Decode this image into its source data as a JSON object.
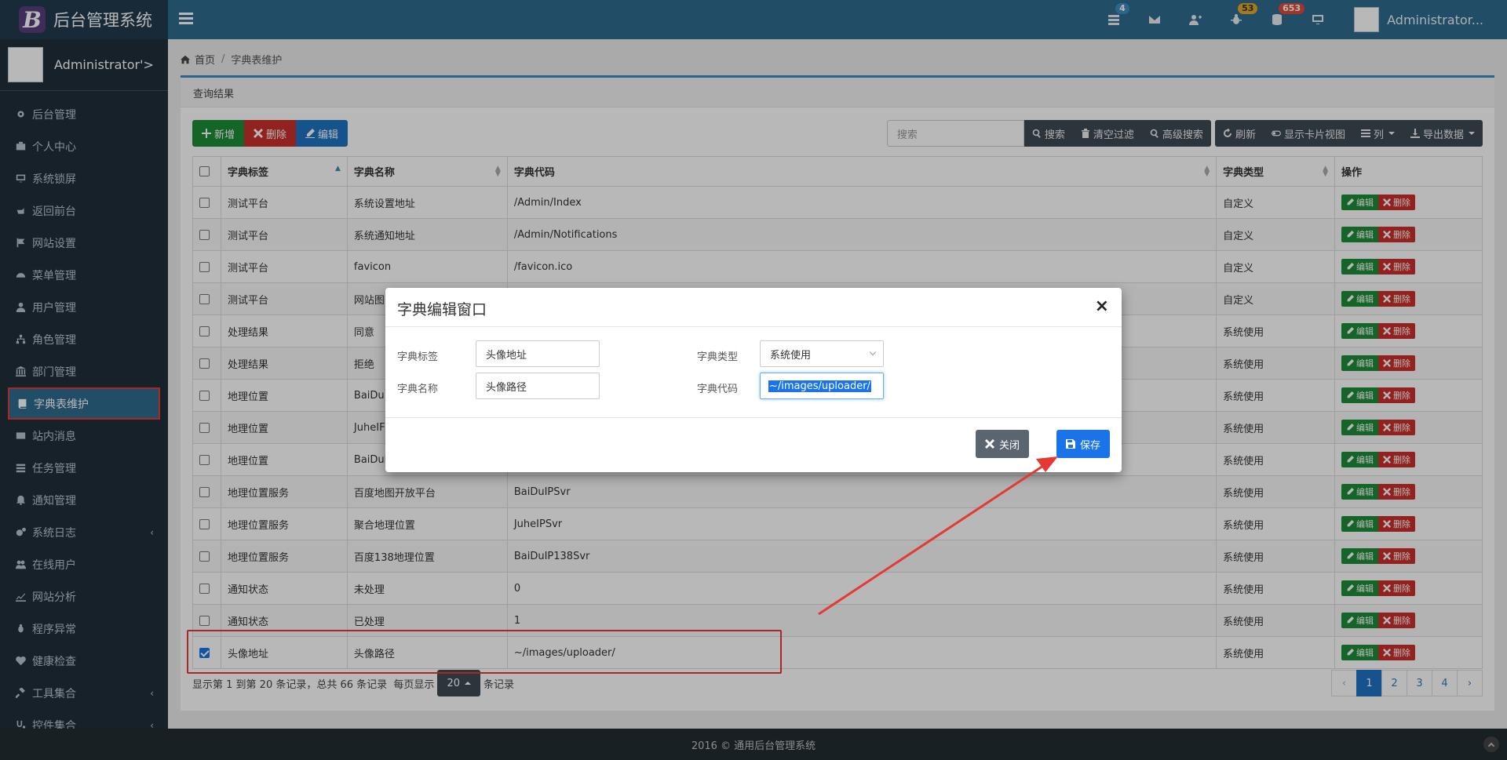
{
  "header": {
    "app_title": "后台管理系统",
    "logo_letter": "B",
    "user_name": "Administrator...",
    "badges": {
      "tasks": "4",
      "alerts": "53",
      "messages": "653"
    }
  },
  "sidebar": {
    "user_name": "Administrator'>",
    "items": [
      {
        "label": "后台管理",
        "icon": "gear-icon"
      },
      {
        "label": "个人中心",
        "icon": "briefcase-icon"
      },
      {
        "label": "系统锁屏",
        "icon": "monitor-icon"
      },
      {
        "label": "返回前台",
        "icon": "hand-pointer-icon"
      },
      {
        "label": "网站设置",
        "icon": "flag-icon"
      },
      {
        "label": "菜单管理",
        "icon": "dashboard-icon"
      },
      {
        "label": "用户管理",
        "icon": "user-icon"
      },
      {
        "label": "角色管理",
        "icon": "sitemap-icon"
      },
      {
        "label": "部门管理",
        "icon": "bank-icon"
      },
      {
        "label": "字典表维护",
        "icon": "book-icon"
      },
      {
        "label": "站内消息",
        "icon": "envelope-icon"
      },
      {
        "label": "任务管理",
        "icon": "tasks-icon"
      },
      {
        "label": "通知管理",
        "icon": "bell-icon"
      },
      {
        "label": "系统日志",
        "icon": "gears-icon"
      },
      {
        "label": "在线用户",
        "icon": "users-icon"
      },
      {
        "label": "网站分析",
        "icon": "line-chart-icon"
      },
      {
        "label": "程序异常",
        "icon": "bug-icon"
      },
      {
        "label": "健康检查",
        "icon": "heartbeat-icon"
      },
      {
        "label": "工具集合",
        "icon": "gavel-icon"
      },
      {
        "label": "控件集合",
        "icon": "stethoscope-icon"
      }
    ]
  },
  "breadcrumb": {
    "home": "首页",
    "separator": "/",
    "current": "字典表维护"
  },
  "panel": {
    "title": "查询结果"
  },
  "toolbar": {
    "add": "新增",
    "delete": "删除",
    "edit": "编辑",
    "search_placeholder": "搜索",
    "search": "搜索",
    "clear_filter": "清空过滤",
    "advanced_search": "高级搜索",
    "refresh": "刷新",
    "card_view": "显示卡片视图",
    "columns": "列",
    "export": "导出数据"
  },
  "table": {
    "headers": [
      "字典标签",
      "字典名称",
      "字典代码",
      "字典类型",
      "操作"
    ],
    "edit_label": "编辑",
    "delete_label": "删除",
    "rows": [
      [
        "测试平台",
        "系统设置地址",
        "/Admin/Index",
        "自定义"
      ],
      [
        "测试平台",
        "系统通知地址",
        "/Admin/Notifications",
        "自定义"
      ],
      [
        "测试平台",
        "favicon",
        "/favicon.ico",
        "自定义"
      ],
      [
        "测试平台",
        "网站图",
        "",
        "自定义"
      ],
      [
        "处理结果",
        "同意",
        "",
        "系统使用"
      ],
      [
        "处理结果",
        "拒绝",
        "",
        "系统使用"
      ],
      [
        "地理位置",
        "BaiDu",
        "",
        "系统使用"
      ],
      [
        "地理位置",
        "JuheIF",
        "",
        "系统使用"
      ],
      [
        "地理位置",
        "BaiDul",
        "",
        "系统使用"
      ],
      [
        "地理位置服务",
        "百度地图开放平台",
        "BaiDuIPSvr",
        "系统使用"
      ],
      [
        "地理位置服务",
        "聚合地理位置",
        "JuheIPSvr",
        "系统使用"
      ],
      [
        "地理位置服务",
        "百度138地理位置",
        "BaiDuIP138Svr",
        "系统使用"
      ],
      [
        "通知状态",
        "未处理",
        "0",
        "系统使用"
      ],
      [
        "通知状态",
        "已处理",
        "1",
        "系统使用"
      ],
      [
        "头像地址",
        "头像路径",
        "~/images/uploader/",
        "系统使用"
      ]
    ]
  },
  "pager": {
    "info_prefix": "显示第 1 到第 20 条记录，总共 66 条记录",
    "per_page_label": "每页显示",
    "page_size": "20",
    "suffix": "条记录",
    "pages": [
      "‹",
      "1",
      "2",
      "3",
      "4",
      "›"
    ]
  },
  "modal": {
    "title": "字典编辑窗口",
    "close_symbol": "×",
    "label_tag": "字典标签",
    "value_tag": "头像地址",
    "label_name": "字典名称",
    "value_name": "头像路径",
    "label_type": "字典类型",
    "value_type": "系统使用",
    "label_code": "字典代码",
    "value_code": "~/images/uploader/",
    "btn_close": "关闭",
    "btn_save": "保存"
  },
  "footer": {
    "text": "2016 © 通用后台管理系统"
  },
  "colors": {
    "header": "#2e6b8f",
    "sidebar": "#1f2f3b",
    "primary": "#1a73e8",
    "danger": "#c9302c",
    "success": "#1e8c3a",
    "annotation": "#e53935"
  }
}
